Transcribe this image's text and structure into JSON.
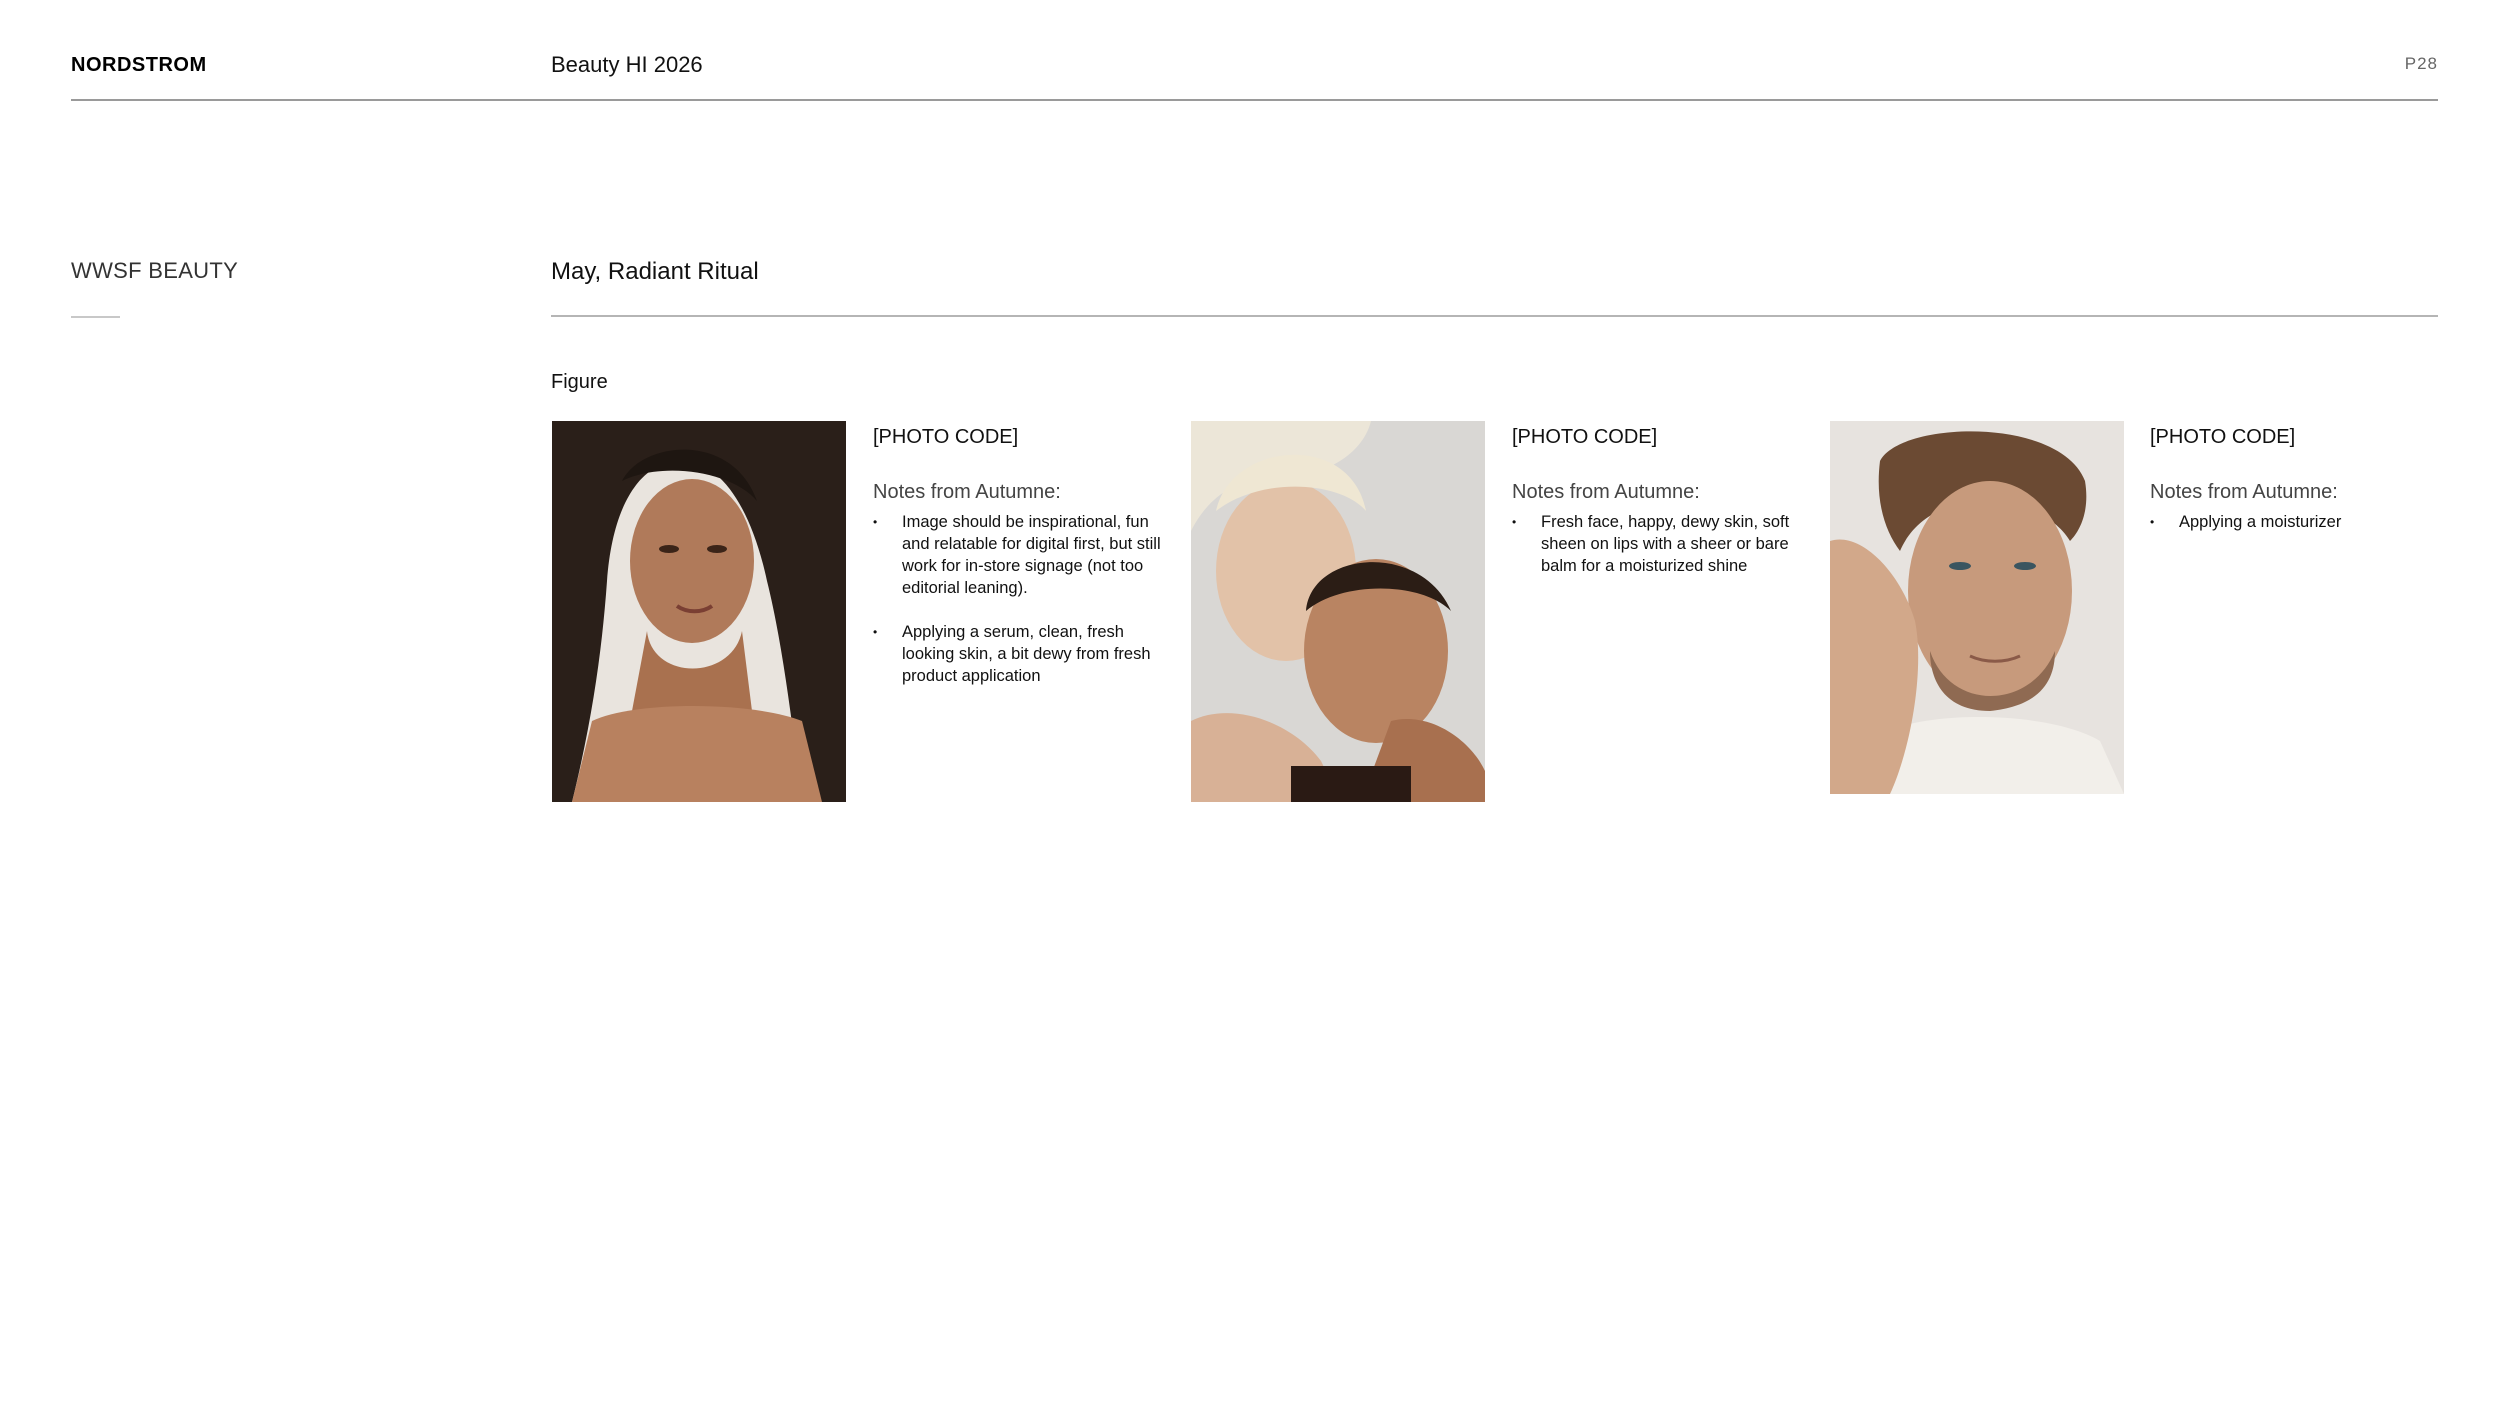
{
  "header": {
    "brand": "NORDSTROM",
    "doc_title": "Beauty HI 2026",
    "page_number": "P28"
  },
  "section": {
    "label": "WWSF BEAUTY",
    "title": "May, Radiant Ritual",
    "figure_label": "Figure"
  },
  "cards": [
    {
      "photo_code": "[PHOTO CODE]",
      "notes_heading": "Notes from Autumne:",
      "notes": [
        "Image should be inspirational, fun and relatable for digital first, but still work for in-store signage (not too editorial leaning).",
        "Applying a serum, clean, fresh looking skin, a bit dewy from fresh product application"
      ]
    },
    {
      "photo_code": "[PHOTO CODE]",
      "notes_heading": "Notes from Autumne:",
      "notes": [
        "Fresh face, happy, dewy skin, soft sheen on lips with a sheer or bare balm for a moisturized shine"
      ]
    },
    {
      "photo_code": "[PHOTO CODE]",
      "notes_heading": "Notes from Autumne:",
      "notes": [
        "Applying a moisturizer"
      ]
    }
  ],
  "colors": {
    "rule": "#9a9a9a",
    "text": "#111111",
    "muted": "#444444"
  }
}
